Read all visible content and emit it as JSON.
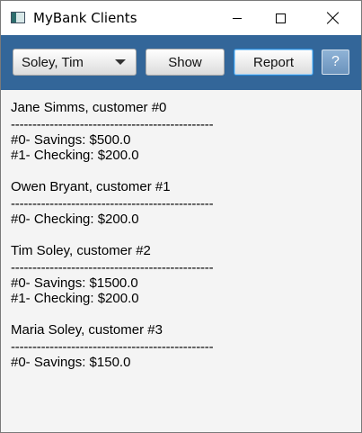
{
  "window": {
    "title": "MyBank Clients",
    "controls": {
      "minimize": "minimize-icon",
      "maximize": "maximize-icon",
      "close": "close-icon"
    }
  },
  "toolbar": {
    "client_select": {
      "selected": "Soley, Tim"
    },
    "show_label": "Show",
    "report_label": "Report",
    "help_label": "?",
    "background_color": "#336699"
  },
  "report": {
    "separator": "-----------------------------------------------",
    "clients": [
      {
        "header": "Jane Simms, customer #0",
        "accounts": [
          "#0- Savings: $500.0",
          "#1- Checking: $200.0"
        ]
      },
      {
        "header": "Owen Bryant, customer #1",
        "accounts": [
          "#0- Checking: $200.0"
        ]
      },
      {
        "header": "Tim Soley, customer #2",
        "accounts": [
          "#0- Savings: $1500.0",
          "#1- Checking: $200.0"
        ]
      },
      {
        "header": "Maria Soley, customer #3",
        "accounts": [
          "#0- Savings: $150.0"
        ]
      }
    ]
  }
}
